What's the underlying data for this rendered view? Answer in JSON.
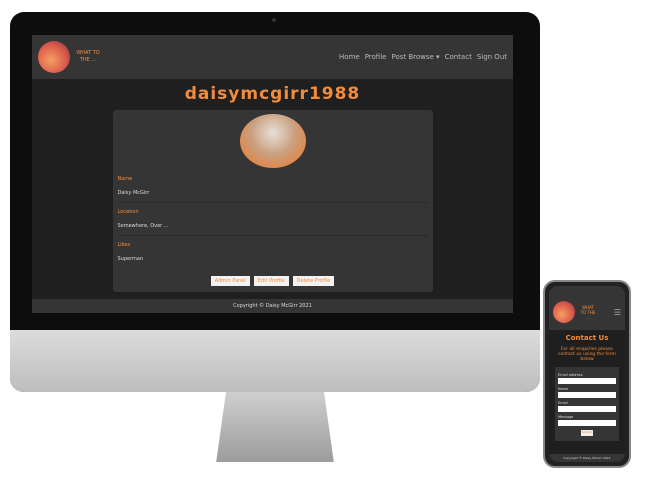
{
  "desktop": {
    "logo_text": "WHAT TO THE ...",
    "nav": [
      "Home",
      "Profile",
      "Post Browse ▾",
      "Contact",
      "Sign Out"
    ],
    "username": "daisymcgirr1988",
    "fields": [
      {
        "label": "Name",
        "value": "Daisy McGirr"
      },
      {
        "label": "Location",
        "value": "Somewhere, Over ..."
      },
      {
        "label": "Likes",
        "value": "Superman"
      }
    ],
    "buttons": [
      "Admin Panel",
      "Edit Profile",
      "Delete Profile"
    ],
    "footer": "Copyright © Daisy McGirr 2021"
  },
  "mobile": {
    "logo_text": "WHAT TO THE ...",
    "menu_icon": "☰",
    "title": "Contact Us",
    "intro": "For all enquiries please contact us using the form below",
    "fields": [
      {
        "label": "Email address",
        "value": "..."
      },
      {
        "label": "Name",
        "value": ""
      },
      {
        "label": "Email",
        "value": ""
      },
      {
        "label": "Message",
        "value": ""
      }
    ],
    "submit": "Submit",
    "footer": "Copyright © Daisy McGirr 2021"
  }
}
